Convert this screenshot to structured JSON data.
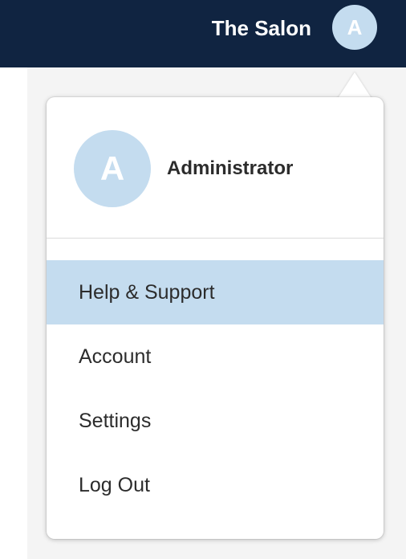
{
  "header": {
    "salon_name": "The Salon",
    "avatar_initial": "A"
  },
  "menu": {
    "profile": {
      "avatar_initial": "A",
      "name": "Administrator"
    },
    "items": [
      {
        "label": "Help & Support",
        "active": true
      },
      {
        "label": "Account",
        "active": false
      },
      {
        "label": "Settings",
        "active": false
      },
      {
        "label": "Log Out",
        "active": false
      }
    ]
  },
  "colors": {
    "topbar": "#102441",
    "avatar": "#c4dcef",
    "highlight": "#c4dcef",
    "text": "#2c2c2c"
  }
}
